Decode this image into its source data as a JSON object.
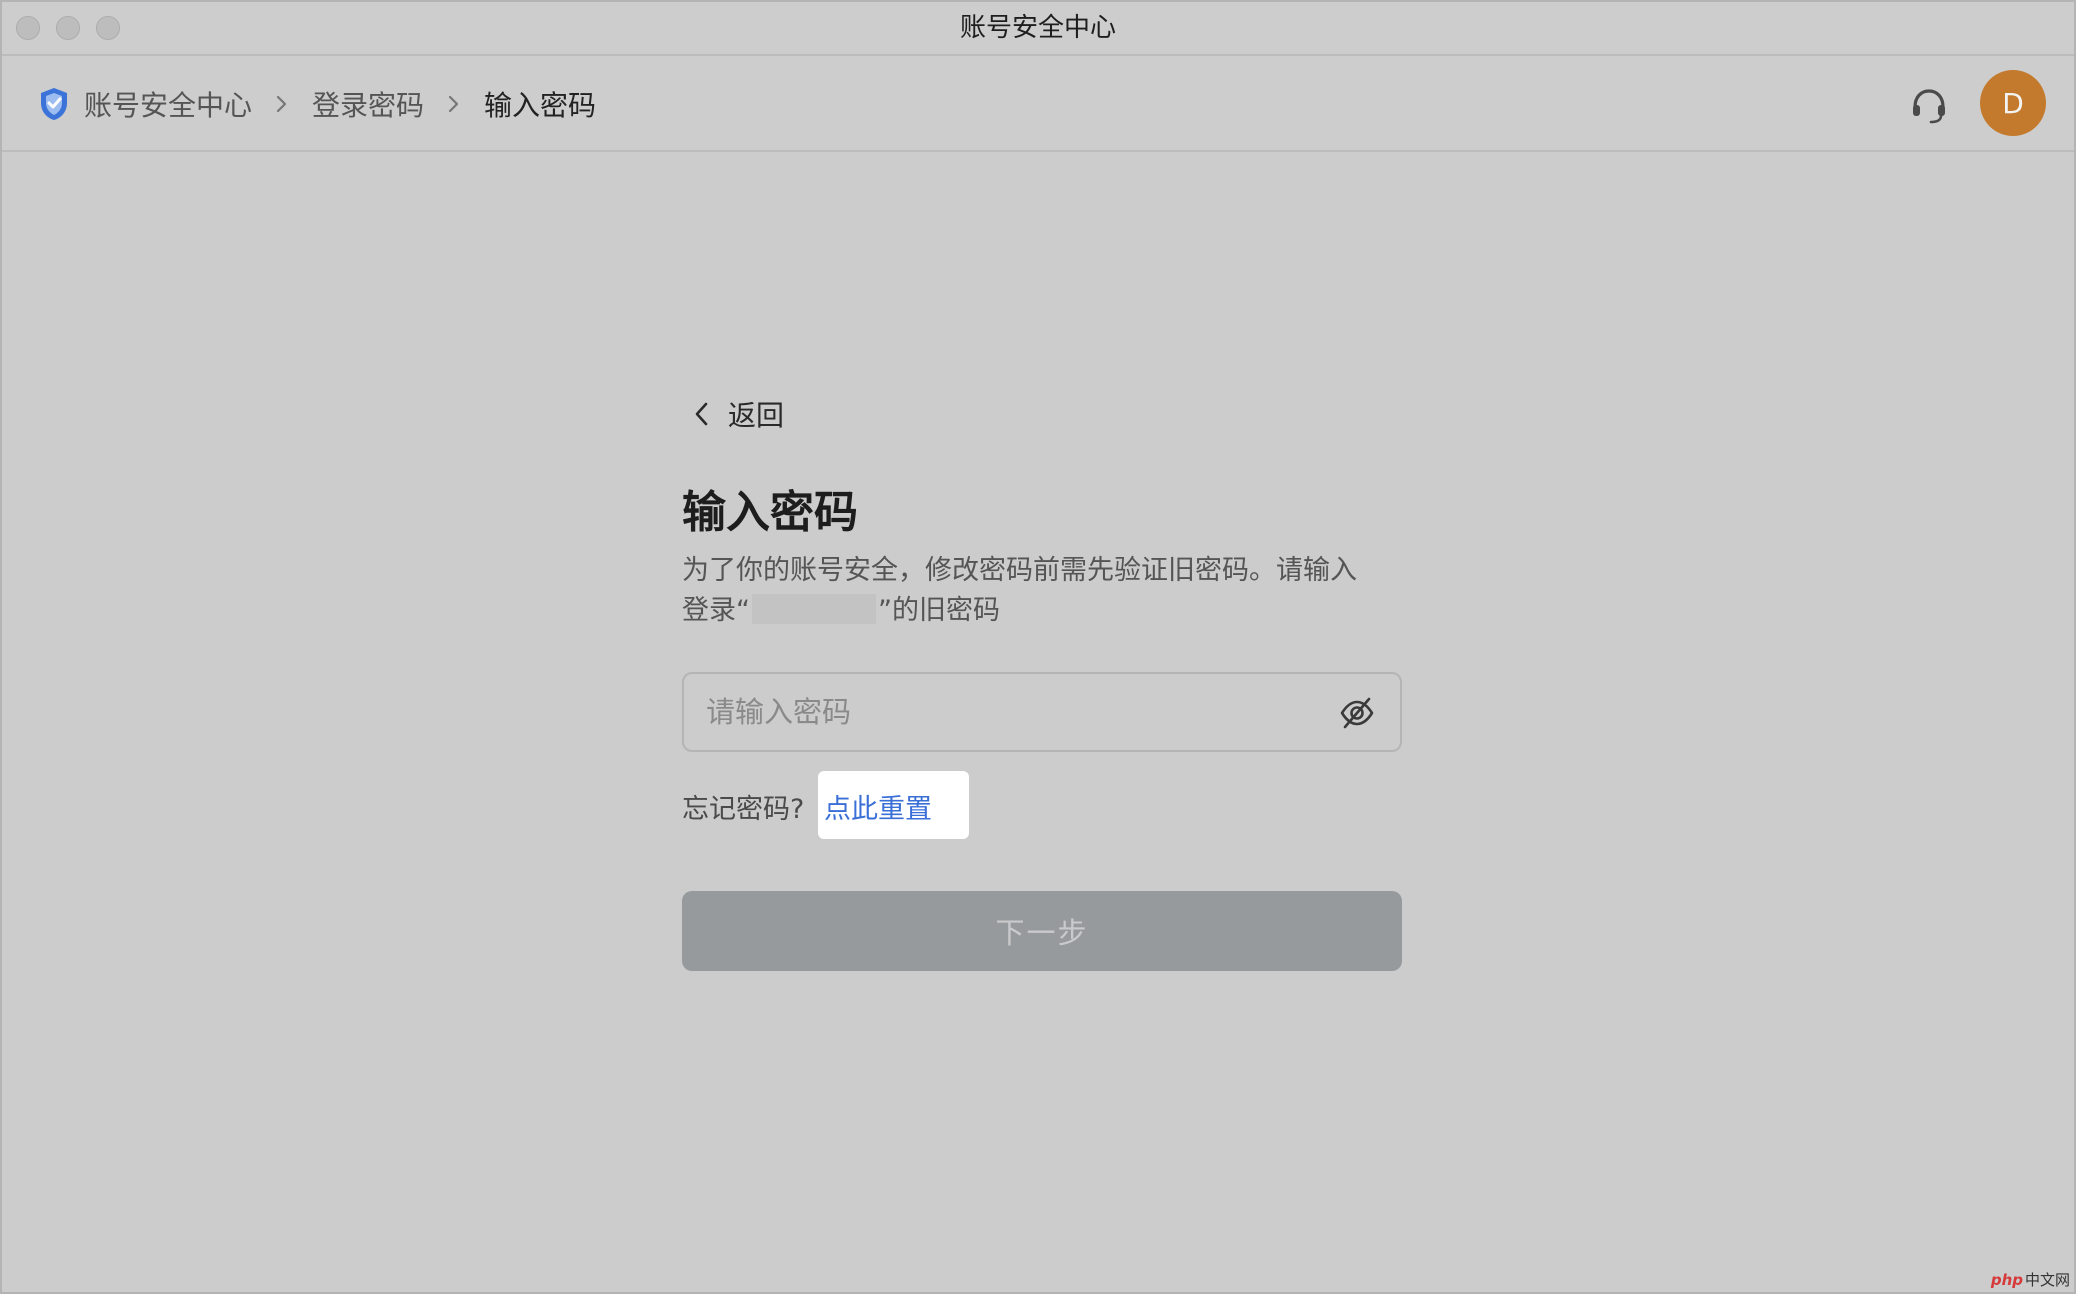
{
  "window": {
    "title": "账号安全中心"
  },
  "breadcrumb": {
    "items": [
      {
        "label": "账号安全中心"
      },
      {
        "label": "登录密码"
      },
      {
        "label": "输入密码"
      }
    ]
  },
  "header": {
    "avatar_initial": "D"
  },
  "form": {
    "back_label": "返回",
    "title": "输入密码",
    "description_line1": "为了你的账号安全，修改密码前需先验证旧密码。请输入",
    "description_prefix": "登录“",
    "description_suffix": "”的旧密码",
    "password_placeholder": "请输入密码",
    "password_value": "",
    "forgot_label": "忘记密码?",
    "reset_link": "点此重置",
    "next_button": "下一步"
  },
  "watermark": {
    "brand": "php",
    "text": "中文网"
  },
  "colors": {
    "link": "#3a6fd8",
    "avatar": "#c47a2c",
    "disabled_button": "#979a9c",
    "shield": "#3b73d9"
  }
}
